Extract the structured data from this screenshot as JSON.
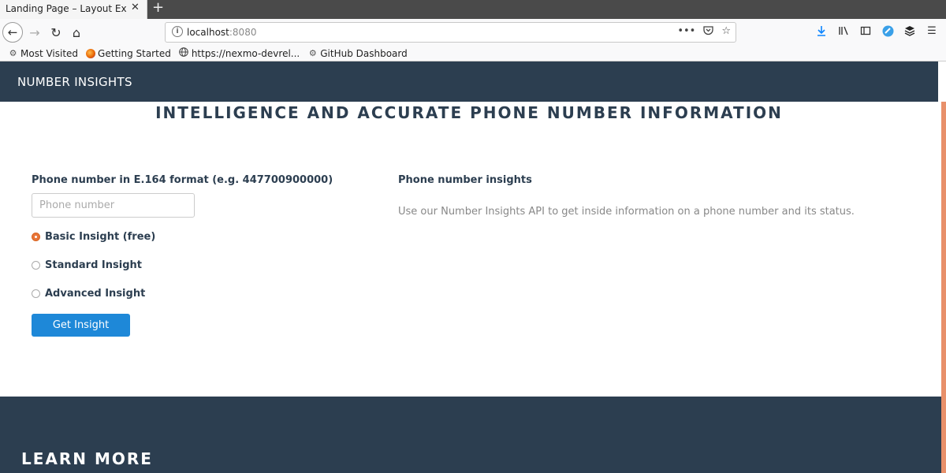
{
  "browser": {
    "tab_title": "Landing Page – Layout Exam",
    "tab_close": "✕",
    "new_tab": "+",
    "url_host": "localhost",
    "url_port": ":8080",
    "bookmarks": [
      {
        "label": "Most Visited",
        "icon": "gear-icon"
      },
      {
        "label": "Getting Started",
        "icon": "firefox-icon"
      },
      {
        "label": "https://nexmo-devrel...",
        "icon": "globe-icon"
      },
      {
        "label": "GitHub Dashboard",
        "icon": "github-icon"
      }
    ]
  },
  "header": {
    "brand": "NUMBER INSIGHTS"
  },
  "hero": {
    "title": "INTELLIGENCE AND ACCURATE PHONE NUMBER INFORMATION"
  },
  "form": {
    "label": "Phone number in E.164 format (e.g. 447700900000)",
    "placeholder": "Phone number",
    "value": "",
    "options": [
      {
        "label": "Basic Insight (free)",
        "checked": true
      },
      {
        "label": "Standard Insight",
        "checked": false
      },
      {
        "label": "Advanced Insight",
        "checked": false
      }
    ],
    "submit_label": "Get Insight"
  },
  "info": {
    "title": "Phone number insights",
    "description": "Use our Number Insights API to get inside information on a phone number and its status."
  },
  "footer": {
    "title": "LEARN MORE"
  },
  "colors": {
    "header_bg": "#2c3e50",
    "button_bg": "#1e88d8",
    "radio_accent": "#e8763a",
    "scroll_accent": "#e8906a"
  }
}
